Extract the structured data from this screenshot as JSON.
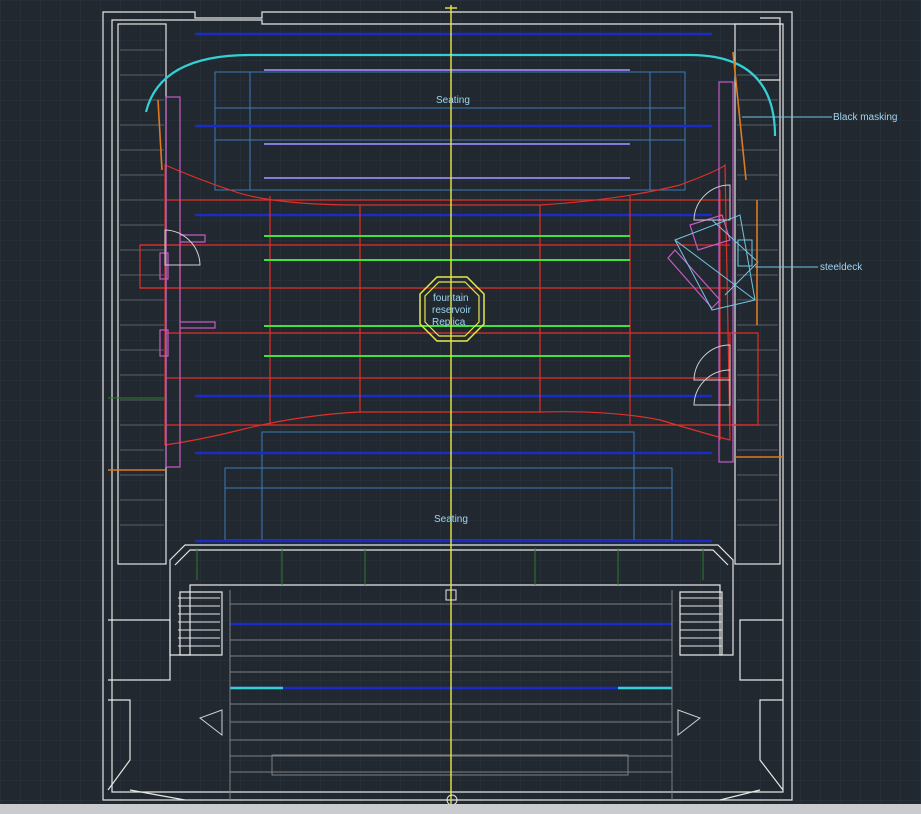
{
  "labels": {
    "seating_upper": "Seating",
    "seating_lower": "Seating",
    "black_masking": "Black masking",
    "steeldeck": "steeldeck",
    "fountain_line1": "fountain",
    "fountain_line2": "reservoir",
    "fountain_line3": "Replica"
  },
  "colors": {
    "background": "#212830",
    "grid": "#2c3540",
    "walls": "#e6e6e6",
    "stage": "#e0302b",
    "seating_blue": "#1a2cc8",
    "green_bars": "#3fe33f",
    "cyan": "#33d0d6",
    "yellow": "#e8e84a",
    "magenta": "#c25cc2",
    "orange": "#e07a1f",
    "label_text": "#9fd6f0"
  }
}
